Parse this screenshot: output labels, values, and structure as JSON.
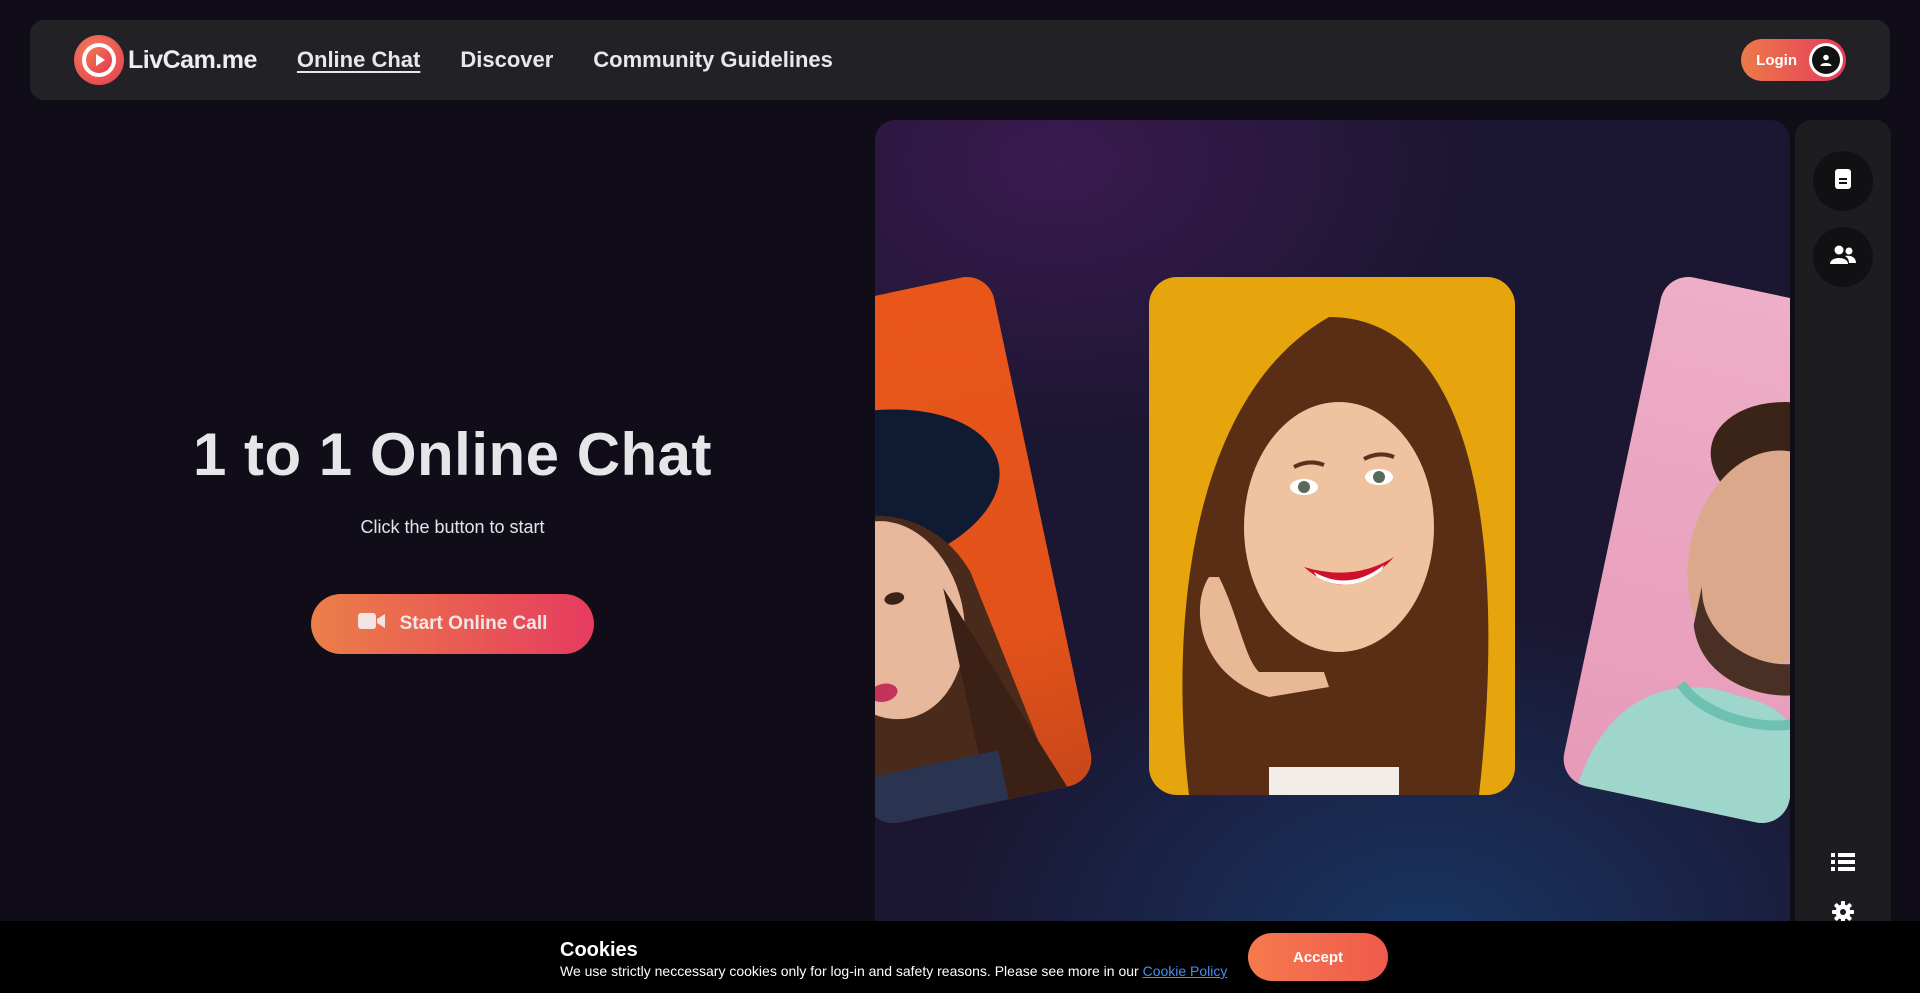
{
  "header": {
    "logo_text": "LivCam.me",
    "nav": [
      {
        "label": "Online Chat",
        "active": true
      },
      {
        "label": "Discover",
        "active": false
      },
      {
        "label": "Community Guidelines",
        "active": false
      }
    ],
    "login_label": "Login"
  },
  "hero": {
    "title": "1 to 1 Online Chat",
    "subtitle": "Click the button to start",
    "cta_label": "Start Online Call",
    "cta_icon": "video-camera-icon"
  },
  "rail": {
    "buttons": [
      {
        "icon": "document-icon"
      },
      {
        "icon": "users-icon"
      }
    ],
    "bottom_icons": [
      {
        "icon": "list-icon"
      },
      {
        "icon": "gear-icon"
      }
    ]
  },
  "cookie": {
    "title": "Cookies",
    "text": "We use strictly neccessary cookies only for log-in and safety reasons. Please see more in our ",
    "link_label": "Cookie Policy",
    "accept_label": "Accept"
  },
  "colors": {
    "accent_start": "#eb7f48",
    "accent_end": "#e63b5f",
    "background": "#100d19",
    "header_bg": "#222226",
    "link": "#4a8df0"
  }
}
